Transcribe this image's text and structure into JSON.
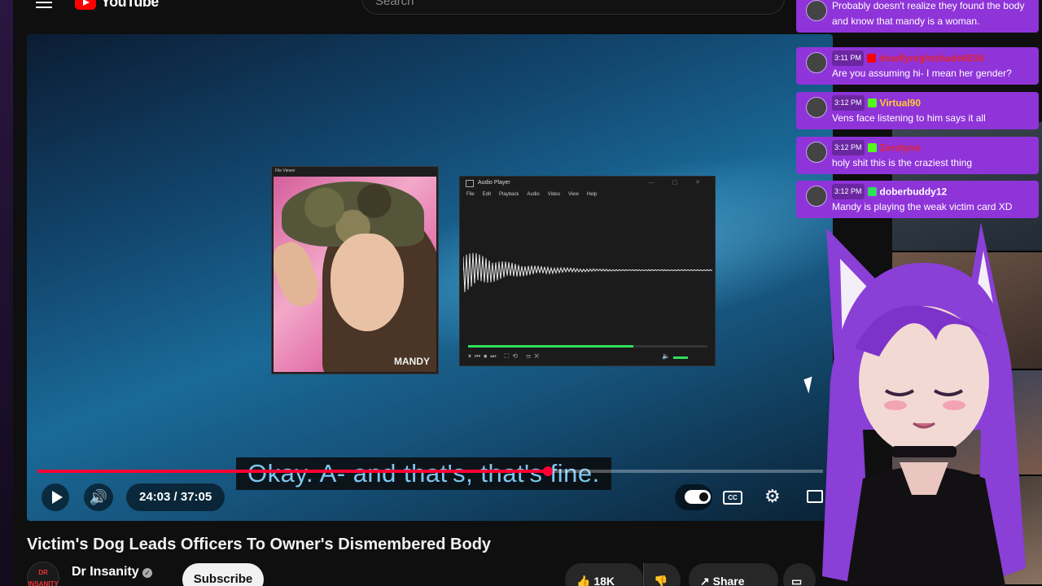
{
  "youtube": {
    "logo_text": "YouTube",
    "search_placeholder": "Search"
  },
  "player": {
    "file_viewer_title": "File Viewer",
    "photo_label": "MANDY",
    "audio_player": {
      "title": "Audio Player",
      "menu": [
        "File",
        "Edit",
        "Playback",
        "Audio",
        "Video",
        "View",
        "Help"
      ],
      "progress_fraction": 0.69
    },
    "caption": "Okay. A- and that's, that's fine.",
    "time": "24:03 / 37:05",
    "progress_fraction": 0.65
  },
  "video": {
    "title": "Victim's Dog Leads Officers To Owner's Dismembered Body",
    "channel": "Dr Insanity",
    "channel_avatar": "DR INSANITY",
    "subscribe_label": "Subscribe",
    "likes": "18K",
    "share_label": "Share"
  },
  "chat": [
    {
      "time": "",
      "user": "",
      "text": "Probably doesn't realize they found the body and know that mandy is a woman.",
      "badge_color": "#53fc18",
      "name_color": "#ffffff"
    },
    {
      "time": "3:11 PM",
      "user": "deadlynightshade6034",
      "text": "Are you assuming hi- I mean her gender?",
      "badge_color": "#ff0000",
      "name_color": "#e0242f"
    },
    {
      "time": "3:12 PM",
      "user": "Virtual90",
      "text": "Vens face listening to him says it all",
      "badge_color": "#53fc18",
      "name_color": "#ffcc33"
    },
    {
      "time": "3:12 PM",
      "user": "Zerolynn",
      "text": "holy shit this is the craziest thing",
      "badge_color": "#53fc18",
      "name_color": "#e0242f"
    },
    {
      "time": "3:12 PM",
      "user": "doberbuddy12",
      "text": "Mandy is playing the weak victim card XD",
      "badge_color": "#2fe05a",
      "name_color": "#ffffff"
    }
  ],
  "colors": {
    "accent": "#ff0033",
    "chat_bg": "#8f34d9",
    "vtuber_hair": "#8a3fd6",
    "audio_progress": "#2fe05a"
  }
}
